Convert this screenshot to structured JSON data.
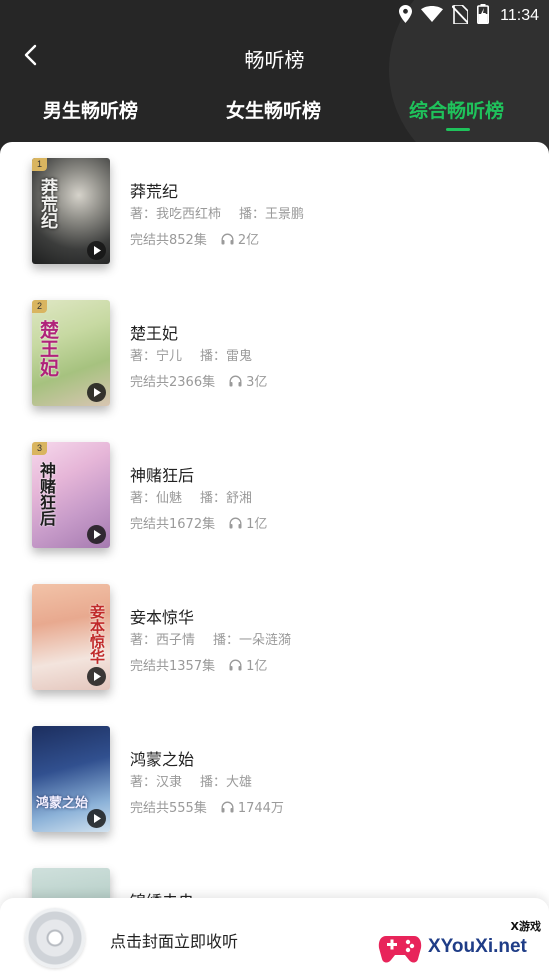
{
  "status_bar": {
    "time": "11:34",
    "icons": [
      "location-icon",
      "wifi-icon",
      "no-sim-icon",
      "battery-charging-icon"
    ]
  },
  "header": {
    "title": "畅听榜",
    "back_icon": "chevron-left-icon"
  },
  "tabs": [
    {
      "label": "男生畅听榜",
      "active": false
    },
    {
      "label": "女生畅听榜",
      "active": false
    },
    {
      "label": "综合畅听榜",
      "active": true
    }
  ],
  "colors": {
    "accent": "#1fc25b",
    "header_bg": "#262626",
    "meta_text": "#9a9a9a",
    "rank_badge": "#d9b560"
  },
  "books": [
    {
      "rank": "1",
      "title": "莽荒纪",
      "author_label": "著：",
      "author": "我吃西红柿",
      "narrator_label": "播：",
      "narrator": "王景鹏",
      "episodes": "完结共852集",
      "plays": "2亿",
      "cover_text": "莽荒纪"
    },
    {
      "rank": "2",
      "title": "楚王妃",
      "author_label": "著：",
      "author": "宁儿",
      "narrator_label": "播：",
      "narrator": "雷鬼",
      "episodes": "完结共2366集",
      "plays": "3亿",
      "cover_text": "楚王妃"
    },
    {
      "rank": "3",
      "title": "神赌狂后",
      "author_label": "著：",
      "author": "仙魅",
      "narrator_label": "播：",
      "narrator": "舒湘",
      "episodes": "完结共1672集",
      "plays": "1亿",
      "cover_text": "神赌狂后"
    },
    {
      "rank": "",
      "title": "妾本惊华",
      "author_label": "著：",
      "author": "西子情",
      "narrator_label": "播：",
      "narrator": "一朵涟漪",
      "episodes": "完结共1357集",
      "plays": "1亿",
      "cover_text": "妾本惊华"
    },
    {
      "rank": "",
      "title": "鸿蒙之始",
      "author_label": "著：",
      "author": "汉隶",
      "narrator_label": "播：",
      "narrator": "大雄",
      "episodes": "完结共555集",
      "plays": "1744万",
      "cover_text": "鸿蒙之始"
    },
    {
      "rank": "",
      "title": "锦绣未央",
      "author_label": "",
      "author": "",
      "narrator_label": "",
      "narrator": "",
      "episodes": "",
      "plays": "",
      "cover_text": ""
    }
  ],
  "player": {
    "hint": "点击封面立即收听",
    "disc_icon": "disc-icon"
  },
  "watermark": {
    "brand": "XYouXi.net",
    "tag": "X游戏",
    "logo_icon": "gamepad-logo-icon"
  }
}
